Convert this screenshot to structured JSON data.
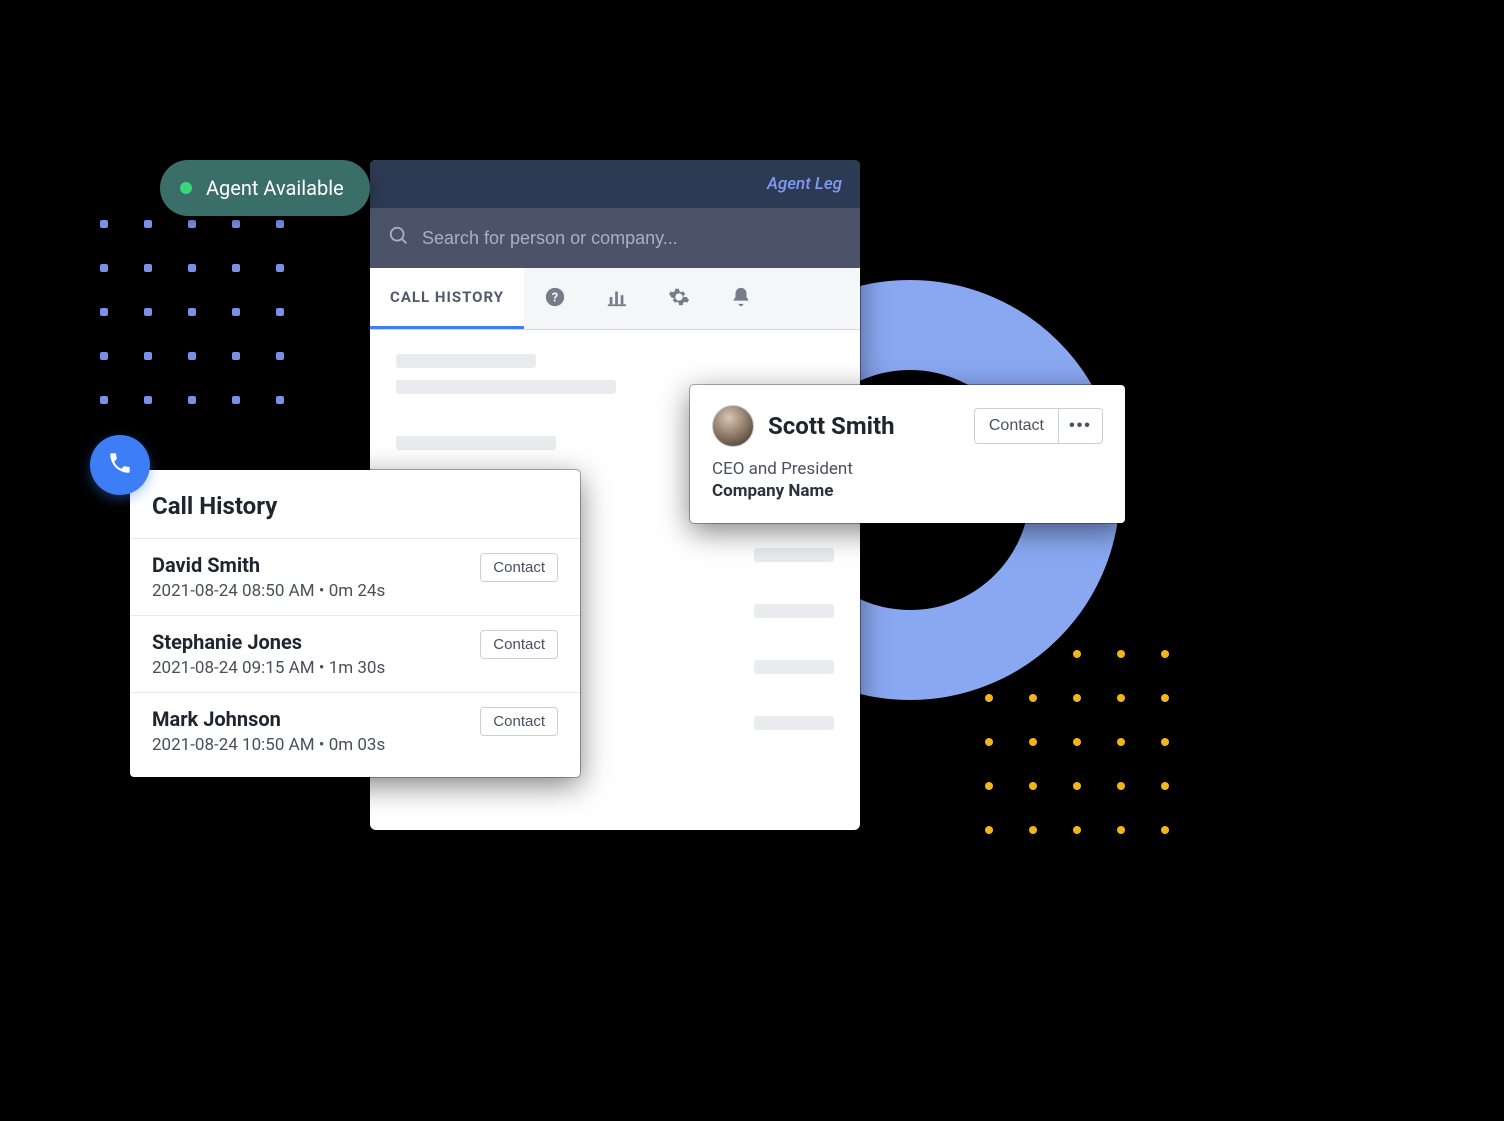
{
  "status": {
    "label": "Agent Available"
  },
  "app": {
    "agent_leg": "Agent Leg",
    "search_placeholder": "Search for person or company...",
    "tabs": {
      "active": "CALL HISTORY"
    }
  },
  "contact_card": {
    "name": "Scott Smith",
    "title": "CEO and President",
    "company": "Company Name",
    "contact_btn": "Contact",
    "more_btn": "•••"
  },
  "call_history": {
    "title": "Call History",
    "contact_btn": "Contact",
    "rows": [
      {
        "name": "David Smith",
        "meta": "2021-08-24 08:50 AM • 0m 24s"
      },
      {
        "name": "Stephanie Jones",
        "meta": "2021-08-24 09:15 AM • 1m 30s"
      },
      {
        "name": "Mark Johnson",
        "meta": "2021-08-24 10:50 AM • 0m 03s"
      }
    ]
  }
}
